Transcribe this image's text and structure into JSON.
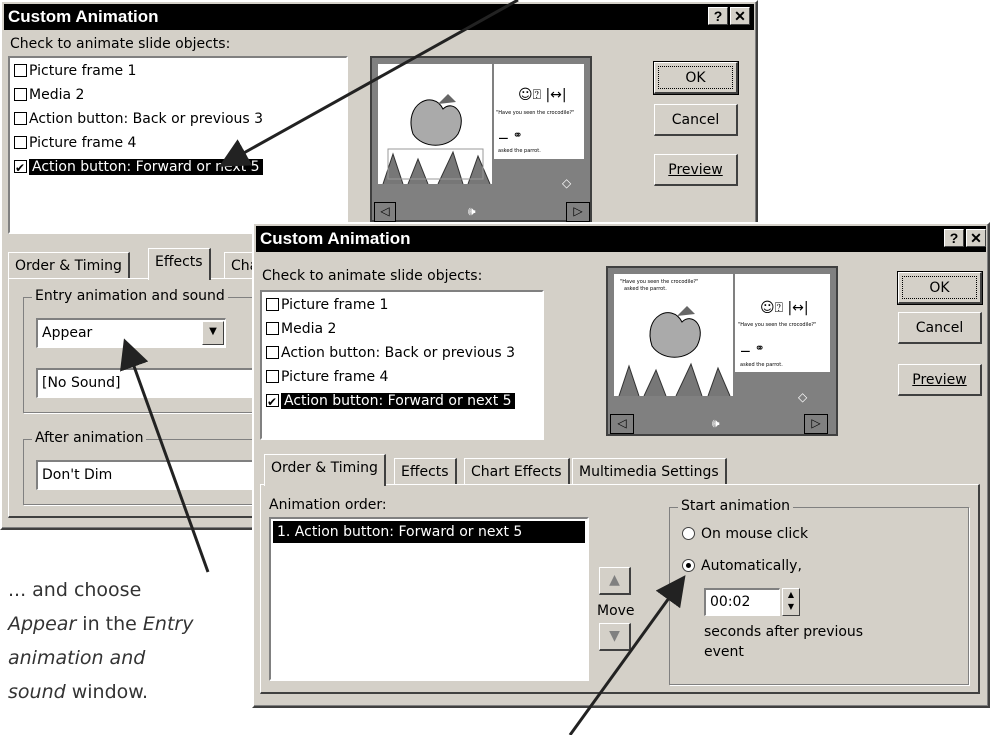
{
  "back_dialog": {
    "title": "Custom Animation",
    "help_btn": "?",
    "close_btn": "✕",
    "objects_label": "Check to animate slide objects:",
    "objects": [
      {
        "label": "Picture frame 1",
        "checked": false
      },
      {
        "label": "Media 2",
        "checked": false
      },
      {
        "label": "Action button: Back or previous 3",
        "checked": false
      },
      {
        "label": "Picture frame 4",
        "checked": false
      },
      {
        "label": "Action button: Forward or next 5",
        "checked": true
      }
    ],
    "ok": "OK",
    "cancel": "Cancel",
    "preview": "Preview",
    "tabs": [
      "Order & Timing",
      "Effects",
      "Cha"
    ],
    "entry_group": "Entry animation and sound",
    "entry_value": "Appear",
    "sound_value": "[No Sound]",
    "after_group": "After animation",
    "after_value": "Don't Dim"
  },
  "front_dialog": {
    "title": "Custom Animation",
    "help_btn": "?",
    "close_btn": "✕",
    "objects_label": "Check to animate slide objects:",
    "objects": [
      {
        "label": "Picture frame 1",
        "checked": false
      },
      {
        "label": "Media 2",
        "checked": false
      },
      {
        "label": "Action button: Back or previous 3",
        "checked": false
      },
      {
        "label": "Picture frame 4",
        "checked": false
      },
      {
        "label": "Action button: Forward or next 5",
        "checked": true
      }
    ],
    "ok": "OK",
    "cancel": "Cancel",
    "preview": "Preview",
    "tabs": [
      "Order & Timing",
      "Effects",
      "Chart Effects",
      "Multimedia Settings"
    ],
    "order_label": "Animation order:",
    "order_items": [
      "1. Action button: Forward or next 5"
    ],
    "move_label": "Move",
    "start_group": "Start animation",
    "radio_mouse": "On mouse click",
    "radio_auto": "Automatically,",
    "time_value": "00:02",
    "seconds_text_1": "seconds after previous",
    "seconds_text_2": "event"
  },
  "slide_preview": {
    "quote": "\"Have you seen the crocodile?\" asked the parrot.",
    "words_1": "\"Have you  seen  the  crocodile?\"",
    "words_2": "asked  the  parrot."
  },
  "caption": {
    "line1": "... and choose",
    "line2a": "Appear",
    "line2b": " in the ",
    "line2c": "Entry",
    "line3": "animation and",
    "line4a": "sound",
    "line4b": " window."
  }
}
